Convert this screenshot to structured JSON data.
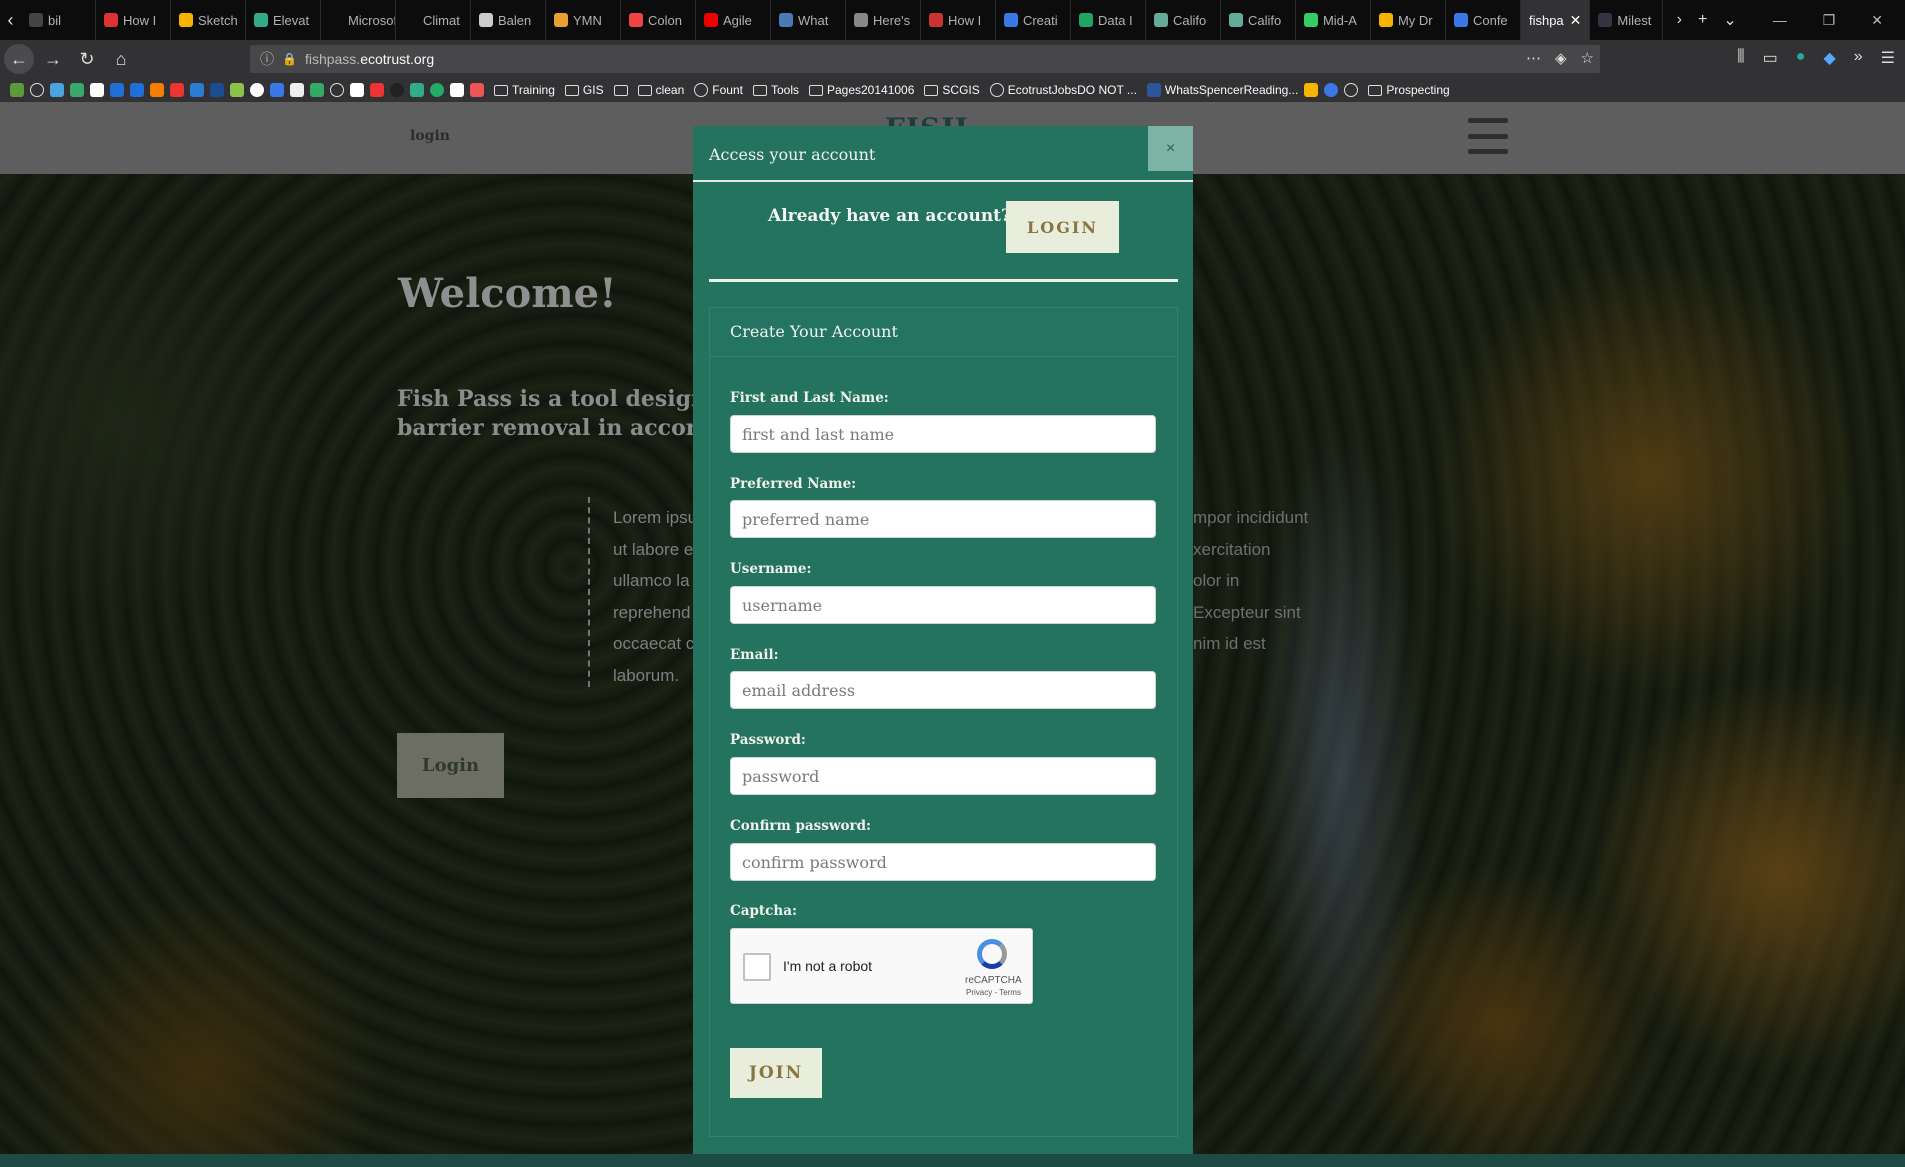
{
  "browser": {
    "tabs": [
      {
        "label": "bil",
        "color": "#444"
      },
      {
        "label": "How I",
        "color": "#d33"
      },
      {
        "label": "Sketch",
        "color": "#f5b400"
      },
      {
        "label": "Elevat",
        "color": "#3a8"
      },
      {
        "label": "Microsoft",
        "color": "#0c0c0d"
      },
      {
        "label": "Climat",
        "color": "#0c0c0d"
      },
      {
        "label": "Balen",
        "color": "#ccc"
      },
      {
        "label": "YMN",
        "color": "#e8a030"
      },
      {
        "label": "Colon",
        "color": "#e44"
      },
      {
        "label": "Agile",
        "color": "#e00"
      },
      {
        "label": "What",
        "color": "#4a7ab5"
      },
      {
        "label": "Here's",
        "color": "#888"
      },
      {
        "label": "How I",
        "color": "#c33"
      },
      {
        "label": "Creati",
        "color": "#3b78e7"
      },
      {
        "label": "Data I",
        "color": "#1fa463"
      },
      {
        "label": "Califo",
        "color": "#6a9"
      },
      {
        "label": "Califo",
        "color": "#6a9"
      },
      {
        "label": "Mid-A",
        "color": "#3c6"
      },
      {
        "label": "My Dr",
        "color": "#f4b400"
      },
      {
        "label": "Confe",
        "color": "#3b78e7"
      }
    ],
    "active_tab": "fishpa",
    "after_tab": "Milest",
    "url_prefix": "fishpass.",
    "url_host": "ecotrust.org",
    "bookmarks": [
      "Training",
      "GIS",
      "clean",
      "Fount",
      "Tools",
      "Pages20141006",
      "SCGIS",
      "EcotrustJobsDO NOT ...",
      "WhatsSpencerReading...",
      "Prospecting"
    ]
  },
  "site": {
    "header_login": "login",
    "logo_text": "FISH",
    "welcome": "Welcome!",
    "tagline_line1": "Fish Pass is a tool designe",
    "tagline_line2": "barrier removal in accord",
    "lorem_left": [
      "Lorem ipsu",
      "ut labore e",
      "ullamco la",
      "reprehend",
      "occaecat c",
      "laborum."
    ],
    "lorem_right": [
      "mpor incididunt",
      "xercitation",
      "olor in",
      "Excepteur sint",
      "nim id est"
    ],
    "login_button": "Login"
  },
  "modal": {
    "title": "Access your account",
    "close": "×",
    "have_account": "Already have an account?",
    "login_button": "LOGIN",
    "create_title": "Create Your Account",
    "fields": {
      "name": {
        "label": "First and Last Name:",
        "placeholder": "first and last name"
      },
      "preferred": {
        "label": "Preferred Name:",
        "placeholder": "preferred name"
      },
      "username": {
        "label": "Username:",
        "placeholder": "username"
      },
      "email": {
        "label": "Email:",
        "placeholder": "email address"
      },
      "password": {
        "label": "Password:",
        "placeholder": "password"
      },
      "confirm": {
        "label": "Confirm password:",
        "placeholder": "confirm password"
      }
    },
    "captcha_label": "Captcha:",
    "captcha_text": "I'm not a robot",
    "captcha_brand": "reCAPTCHA",
    "captcha_terms": "Privacy - Terms",
    "join_button": "JOIN"
  }
}
